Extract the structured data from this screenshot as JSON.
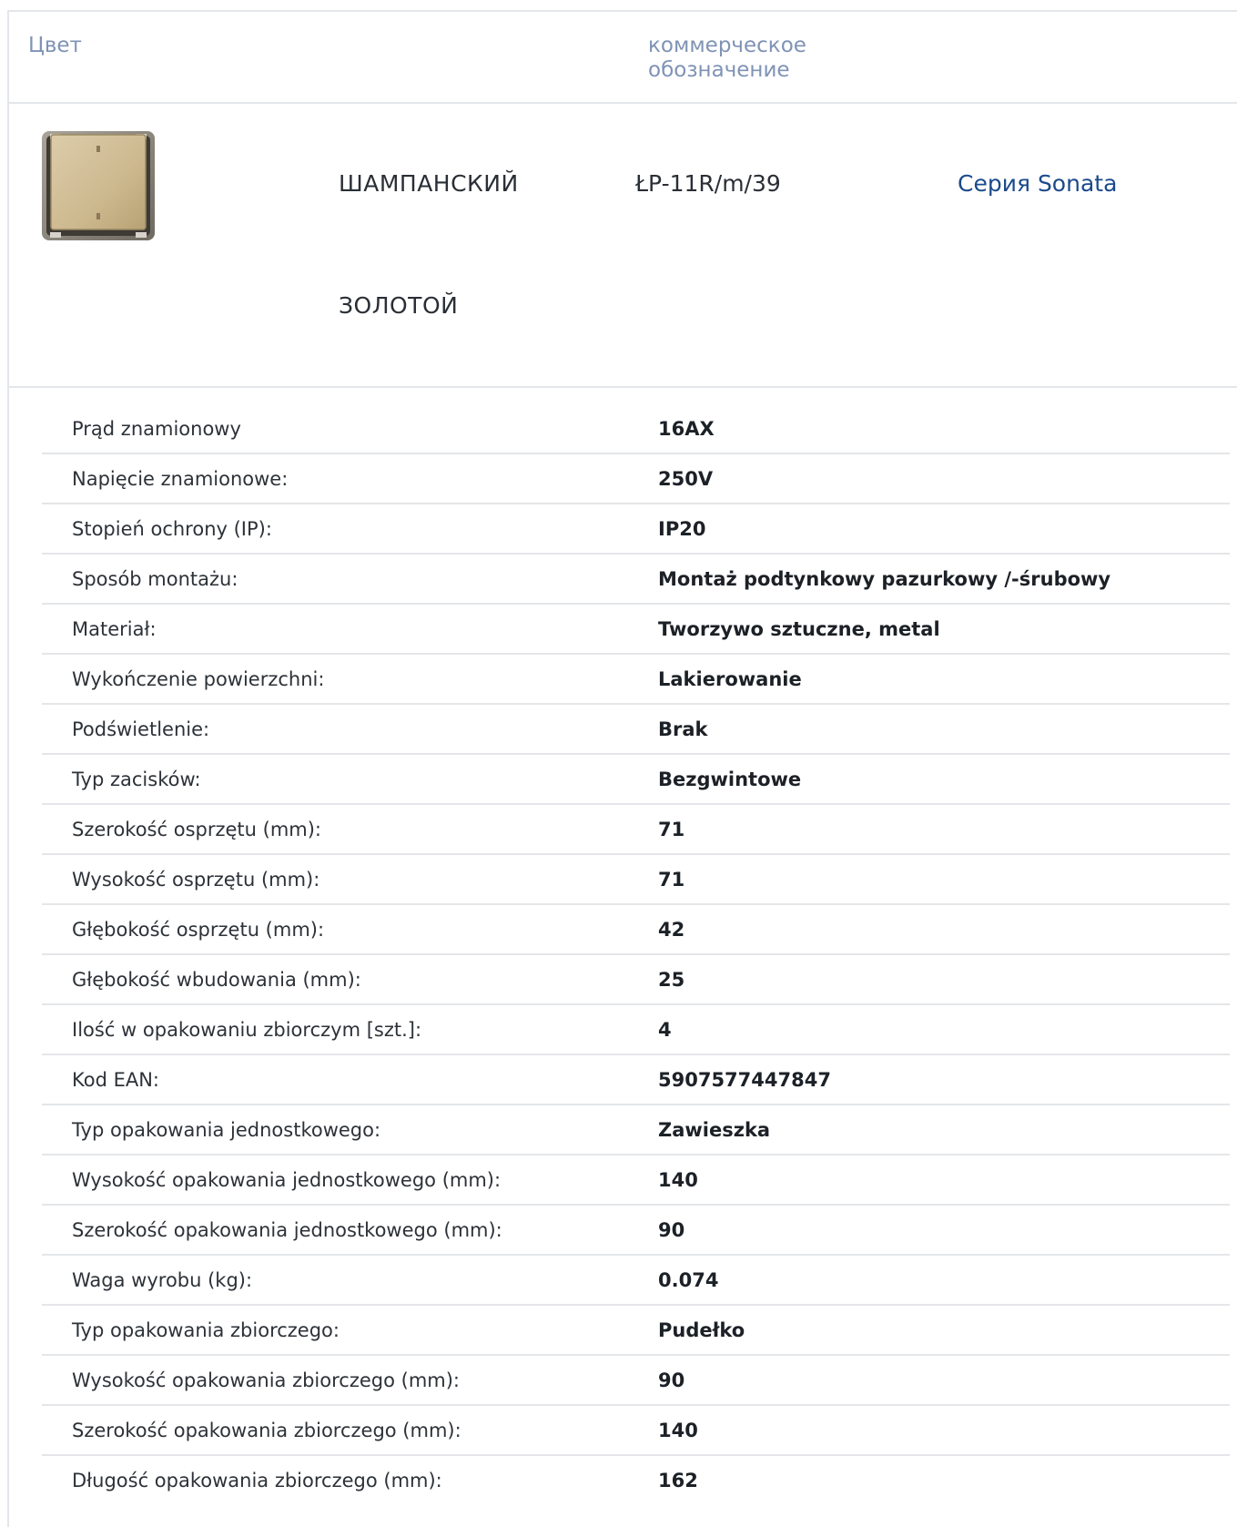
{
  "header": {
    "color_label": "Цвет",
    "code_label_line1": "коммерческое",
    "code_label_line2": "обозначение"
  },
  "product": {
    "thumbnail_icon": "switch-product-image",
    "color_names": [
      "ШАМПАНСКИЙ",
      "ЗОЛОТОЙ"
    ],
    "code": "ŁP-11R/m/39",
    "series_link": "Серия Sonata",
    "colors": {
      "accent_link": "#1b4a8c",
      "header_text": "#7f93b5"
    }
  },
  "specs": [
    {
      "name": "Prąd znamionowy",
      "value": "16AX"
    },
    {
      "name": "Napięcie znamionowe:",
      "value": "250V"
    },
    {
      "name": "Stopień ochrony (IP):",
      "value": "IP20"
    },
    {
      "name": "Sposób montażu:",
      "value": "Montaż podtynkowy pazurkowy /-śrubowy"
    },
    {
      "name": "Materiał:",
      "value": "Tworzywo sztuczne, metal"
    },
    {
      "name": "Wykończenie powierzchni:",
      "value": "Lakierowanie"
    },
    {
      "name": "Podświetlenie:",
      "value": "Brak"
    },
    {
      "name": "Typ zacisków:",
      "value": "Bezgwintowe"
    },
    {
      "name": "Szerokość osprzętu (mm):",
      "value": "71"
    },
    {
      "name": "Wysokość osprzętu (mm):",
      "value": "71"
    },
    {
      "name": "Głębokość osprzętu (mm):",
      "value": "42"
    },
    {
      "name": "Głębokość wbudowania (mm):",
      "value": "25"
    },
    {
      "name": "Ilość w opakowaniu zbiorczym [szt.]:",
      "value": "4"
    },
    {
      "name": "Kod EAN:",
      "value": "5907577447847"
    },
    {
      "name": "Typ opakowania jednostkowego:",
      "value": "Zawieszka"
    },
    {
      "name": "Wysokość opakowania jednostkowego (mm):",
      "value": "140"
    },
    {
      "name": "Szerokość opakowania jednostkowego (mm):",
      "value": "90"
    },
    {
      "name": "Waga wyrobu (kg):",
      "value": "0.074"
    },
    {
      "name": "Typ opakowania zbiorczego:",
      "value": "Pudełko"
    },
    {
      "name": "Wysokość opakowania zbiorczego (mm):",
      "value": "90"
    },
    {
      "name": "Szerokość opakowania zbiorczego (mm):",
      "value": "140"
    },
    {
      "name": "Długość opakowania zbiorczego (mm):",
      "value": "162"
    }
  ]
}
